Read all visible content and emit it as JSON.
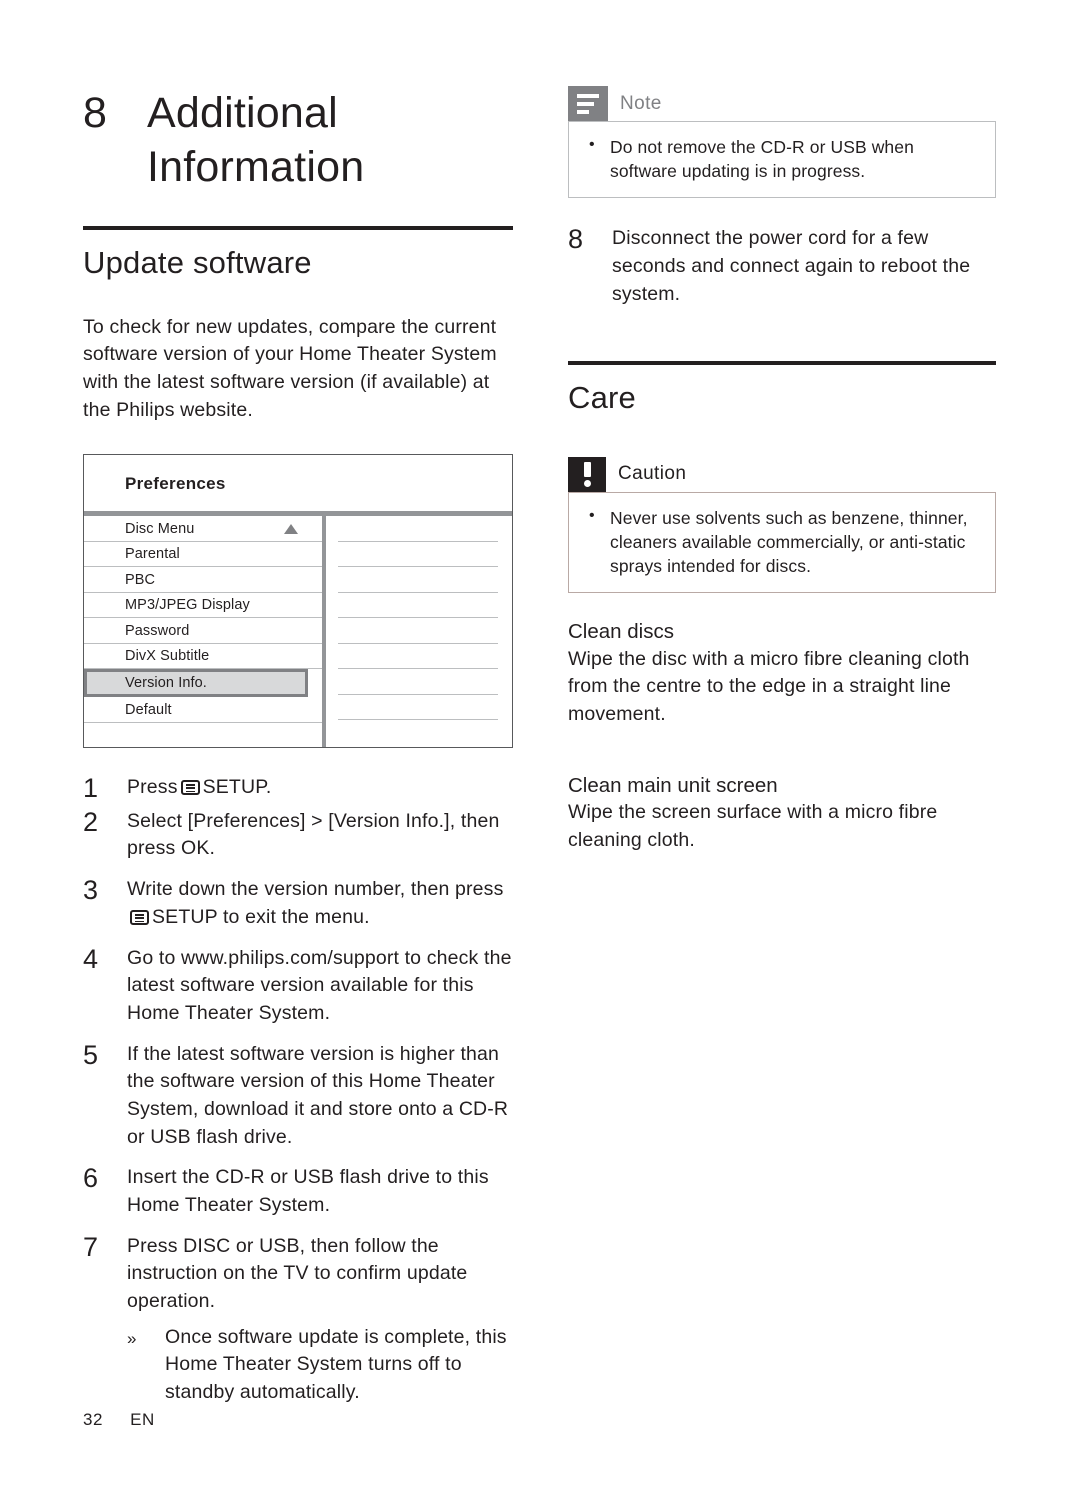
{
  "chapter": {
    "number": "8",
    "title_line1": "Additional",
    "title_line2": "Information"
  },
  "left_column": {
    "section_heading": "Update software",
    "intro_paragraph": "To check for new updates, compare the current software version of your Home Theater System with the latest software version (if available) at the Philips website.",
    "preferences_menu": {
      "title": "Preferences",
      "items": [
        "Disc Menu",
        "Parental",
        "PBC",
        "MP3/JPEG Display",
        "Password",
        "DivX Subtitle",
        "Version Info.",
        "Default"
      ],
      "selected_item": "Version Info.",
      "scroll_arrow": "triangle-up"
    },
    "steps": [
      {
        "num": "1",
        "text_before": "Press",
        "has_setup_icon": true,
        "text_after": "SETUP."
      },
      {
        "num": "2",
        "text_before": "Select [Preferences] > [Version Info.], then press OK.",
        "has_setup_icon": false,
        "text_after": ""
      },
      {
        "num": "3",
        "text_before": "Write down the version number, then press",
        "has_setup_icon": true,
        "text_after": "SETUP to exit the menu."
      },
      {
        "num": "4",
        "text_before": "Go to www.philips.com/support to check the latest software version available for this Home Theater System.",
        "has_setup_icon": false,
        "text_after": ""
      },
      {
        "num": "5",
        "text_before": "If the latest software version is higher than the software version of this Home Theater System, download it and store onto a CD-R or USB flash drive.",
        "has_setup_icon": false,
        "text_after": ""
      },
      {
        "num": "6",
        "text_before": "Insert the CD-R or USB flash drive to this Home Theater System.",
        "has_setup_icon": false,
        "text_after": ""
      },
      {
        "num": "7",
        "text_before": "Press DISC or USB, then follow the instruction on the TV to confirm update operation.",
        "has_setup_icon": false,
        "text_after": ""
      }
    ],
    "substep": {
      "marker": "»",
      "text": "Once software update is complete, this Home Theater System turns off to standby automatically."
    }
  },
  "right_column": {
    "note_box": {
      "label": "Note",
      "icon": "note-lines-icon",
      "items": [
        "Do not remove the CD-R or USB when software updating is in progress."
      ]
    },
    "step8": {
      "num": "8",
      "text": "Disconnect the power cord for a few seconds and connect again to reboot the system."
    },
    "section_heading": "Care",
    "caution_box": {
      "label": "Caution",
      "icon": "exclamation-icon",
      "items": [
        "Never use solvents such as benzene, thinner, cleaners available commercially, or anti-static sprays intended for discs."
      ]
    },
    "clean_discs": {
      "heading": "Clean discs",
      "body": "Wipe the disc with a micro fibre cleaning cloth from the centre to the edge in a straight line movement."
    },
    "clean_screen": {
      "heading": "Clean main unit screen",
      "body": "Wipe the screen surface with a micro fibre cleaning cloth."
    }
  },
  "footer": {
    "page_number": "32",
    "language": "EN"
  },
  "colors": {
    "text": "#231f20",
    "rule": "#231f20",
    "note_gray": "#808184",
    "box_border": "#bcbec0",
    "caution_border": "#b9a9a5",
    "menu_divider": "#939598",
    "selected_fill": "#d8d9da"
  }
}
